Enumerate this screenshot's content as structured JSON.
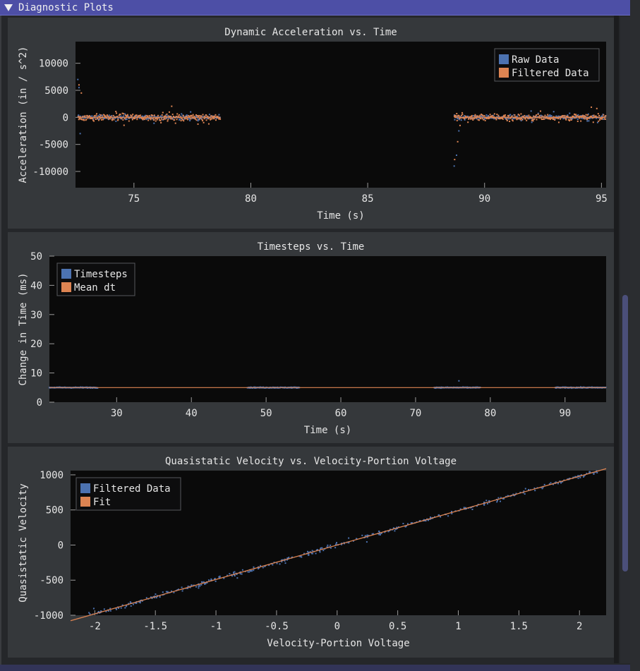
{
  "window": {
    "title": "Diagnostic Plots"
  },
  "colors": {
    "raw": "#4c72b0",
    "filtered": "#dd8452",
    "plot_bg": "#0a0a0a",
    "panel_bg": "#35383b"
  },
  "chart_data": [
    {
      "type": "scatter",
      "title": "Dynamic Acceleration vs. Time",
      "xlabel": "Time (s)",
      "ylabel": "Acceleration (in / s^2)",
      "xlim": [
        72.5,
        95.2
      ],
      "ylim": [
        -13000,
        14000
      ],
      "xticks": [
        75,
        80,
        85,
        90,
        95
      ],
      "yticks": [
        10000,
        5000,
        0,
        -5000,
        -10000
      ],
      "ytick_labels": [
        "10000",
        "5000",
        "0",
        "-5000",
        "-10000"
      ],
      "legend": {
        "placement": "top-right",
        "entries": [
          "Raw Data",
          "Filtered Data"
        ]
      },
      "series": [
        {
          "name": "Raw Data",
          "segments": [
            [
              72.6,
              78.7
            ],
            [
              88.7,
              95.2
            ]
          ],
          "noise": 400,
          "spikes": [
            [
              72.6,
              7000
            ],
            [
              72.65,
              5500
            ],
            [
              72.7,
              -3000
            ],
            [
              88.7,
              -9000
            ],
            [
              88.8,
              -7000
            ],
            [
              88.9,
              -2500
            ]
          ]
        },
        {
          "name": "Filtered Data",
          "segments": [
            [
              72.6,
              78.7
            ],
            [
              88.7,
              95.2
            ]
          ],
          "noise": 600,
          "spikes": [
            [
              72.65,
              6000
            ],
            [
              72.75,
              4500
            ],
            [
              88.72,
              -7800
            ],
            [
              88.85,
              -4500
            ],
            [
              88.95,
              -1500
            ]
          ]
        }
      ]
    },
    {
      "type": "scatter",
      "title": "Timesteps vs. Time",
      "xlabel": "Time (s)",
      "ylabel": "Change in Time (ms)",
      "xlim": [
        21.0,
        95.5
      ],
      "ylim": [
        0,
        50
      ],
      "xticks": [
        30,
        40,
        50,
        60,
        70,
        80,
        90
      ],
      "yticks": [
        0,
        10,
        20,
        30,
        40,
        50
      ],
      "legend": {
        "placement": "top-left",
        "entries": [
          "Timesteps",
          "Mean dt"
        ]
      },
      "series": [
        {
          "name": "Timesteps",
          "segments": [
            [
              21.0,
              27.5
            ],
            [
              47.5,
              54.5
            ],
            [
              72.5,
              78.7
            ],
            [
              88.7,
              95.5
            ]
          ],
          "value": 5.0
        },
        {
          "name": "Mean dt",
          "value": 5.0
        }
      ]
    },
    {
      "type": "scatter",
      "title": "Quasistatic Velocity vs. Velocity-Portion Voltage",
      "xlabel": "Velocity-Portion Voltage",
      "ylabel": "Quasistatic Velocity",
      "xlim": [
        -2.2,
        2.22
      ],
      "ylim": [
        -1000,
        1060
      ],
      "xticks": [
        -2,
        -1.5,
        -1,
        -0.5,
        0,
        0.5,
        1,
        1.5,
        2
      ],
      "yticks": [
        1000,
        500,
        0,
        -500,
        -1000
      ],
      "legend": {
        "placement": "top-left",
        "entries": [
          "Filtered Data",
          "Fit"
        ]
      },
      "series": [
        {
          "name": "Filtered Data",
          "x_range": [
            -2.15,
            2.15
          ],
          "slope": 490,
          "noise": 30
        },
        {
          "name": "Fit",
          "slope": 490,
          "intercept": 0
        }
      ]
    }
  ]
}
